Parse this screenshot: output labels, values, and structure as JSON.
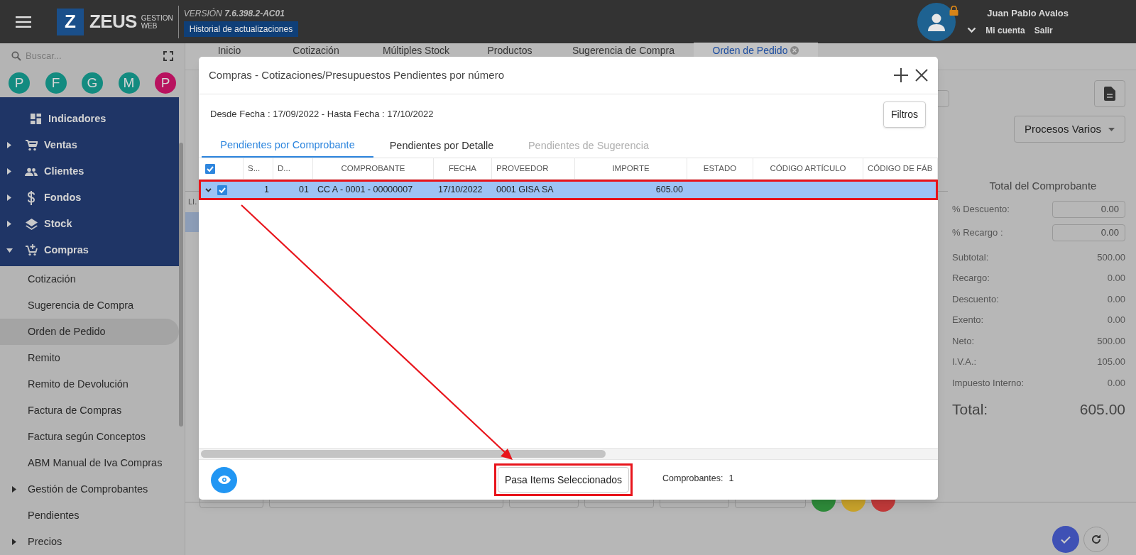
{
  "app": {
    "logo_letter": "Z",
    "brand": "ZEUS",
    "brand_sub": [
      "GESTION",
      "WEB"
    ],
    "version_label": "VERSIÓN",
    "version": "7.6.398.2-AC01",
    "changelog_link": "Historial de actualizaciones"
  },
  "user": {
    "name": "Juan Pablo Avalos",
    "links": [
      "Mi cuenta",
      "Salir"
    ],
    "locked": true
  },
  "sidebar": {
    "search_placeholder": "Buscar...",
    "shortcuts": [
      {
        "letter": "P",
        "color": "#138b80"
      },
      {
        "letter": "F",
        "color": "#138b80"
      },
      {
        "letter": "G",
        "color": "#138b80"
      },
      {
        "letter": "M",
        "color": "#138b80"
      },
      {
        "letter": "P",
        "color": "#b8125f"
      }
    ],
    "items": [
      {
        "label": "Indicadores",
        "expandable": false
      },
      {
        "label": "Ventas",
        "expandable": true,
        "expanded": false
      },
      {
        "label": "Clientes",
        "expandable": true,
        "expanded": false
      },
      {
        "label": "Fondos",
        "expandable": true,
        "expanded": false
      },
      {
        "label": "Stock",
        "expandable": true,
        "expanded": false
      },
      {
        "label": "Compras",
        "expandable": true,
        "expanded": true,
        "children": [
          {
            "label": "Cotización",
            "expandable": false,
            "selected": false
          },
          {
            "label": "Sugerencia de Compra",
            "expandable": false,
            "selected": false
          },
          {
            "label": "Orden de Pedido",
            "expandable": false,
            "selected": true
          },
          {
            "label": "Remito",
            "expandable": false,
            "selected": false
          },
          {
            "label": "Remito de Devolución",
            "expandable": false,
            "selected": false
          },
          {
            "label": "Factura de Compras",
            "expandable": false,
            "selected": false
          },
          {
            "label": "Factura según Conceptos",
            "expandable": false,
            "selected": false
          },
          {
            "label": "ABM Manual de Iva Compras",
            "expandable": false,
            "selected": false
          },
          {
            "label": "Gestión de Comprobantes",
            "expandable": true,
            "selected": false
          },
          {
            "label": "Pendientes",
            "expandable": false,
            "selected": false
          },
          {
            "label": "Precios",
            "expandable": true,
            "selected": false
          }
        ]
      }
    ]
  },
  "main_tabs": [
    {
      "label": "Inicio",
      "selected": false
    },
    {
      "label": "Cotización",
      "selected": false
    },
    {
      "label": "Múltiples Stock",
      "selected": false
    },
    {
      "label": "Productos",
      "selected": false
    },
    {
      "label": "Sugerencia de Compra",
      "selected": false
    },
    {
      "label": "Orden de Pedido",
      "selected": true
    }
  ],
  "background_table": {
    "column_1": "LI."
  },
  "modal": {
    "title": "Compras - Cotizaciones/Presupuestos Pendientes por número",
    "date_range": "Desde Fecha : 17/09/2022 - Hasta Fecha : 17/10/2022",
    "filter_button": "Filtros",
    "tabs": [
      {
        "label": "Pendientes por Comprobante",
        "selected": true,
        "disabled": false
      },
      {
        "label": "Pendientes por Detalle",
        "selected": false,
        "disabled": false
      },
      {
        "label": "Pendientes de Sugerencia",
        "selected": false,
        "disabled": true
      }
    ],
    "header_checked": true,
    "columns": [
      "S...",
      "D...",
      "COMPROBANTE",
      "FECHA",
      "PROVEEDOR",
      "IMPORTE",
      "ESTADO",
      "CÓDIGO ARTÍCULO",
      "CÓDIGO DE FÁB"
    ],
    "rows": [
      {
        "checked": true,
        "selected": true,
        "cells": [
          "1",
          "01",
          "CC A - 0001 - 00000007",
          "17/10/2022",
          "0001 GISA SA",
          "605.00"
        ]
      }
    ],
    "pass_button": "Pasa Items Seleccionados",
    "count_label": "Comprobantes:",
    "count": "1"
  },
  "totals": {
    "menu_button": "Procesos Varios",
    "title": "Total del Comprobante",
    "inputs": [
      {
        "label": "% Descuento:",
        "value": "0.00"
      },
      {
        "label": "% Recargo :",
        "value": "0.00"
      }
    ],
    "rows": [
      {
        "label": "Subtotal:",
        "value": "500.00"
      },
      {
        "label": "Recargo:",
        "value": "0.00"
      },
      {
        "label": "Descuento:",
        "value": "0.00"
      },
      {
        "label": "Exento:",
        "value": "0.00"
      },
      {
        "label": "Neto:",
        "value": "500.00"
      },
      {
        "label": "I.V.A.:",
        "value": "105.00"
      },
      {
        "label": "Impuesto Interno:",
        "value": "0.00"
      }
    ],
    "total": {
      "label": "Total:",
      "value": "605.00"
    }
  }
}
